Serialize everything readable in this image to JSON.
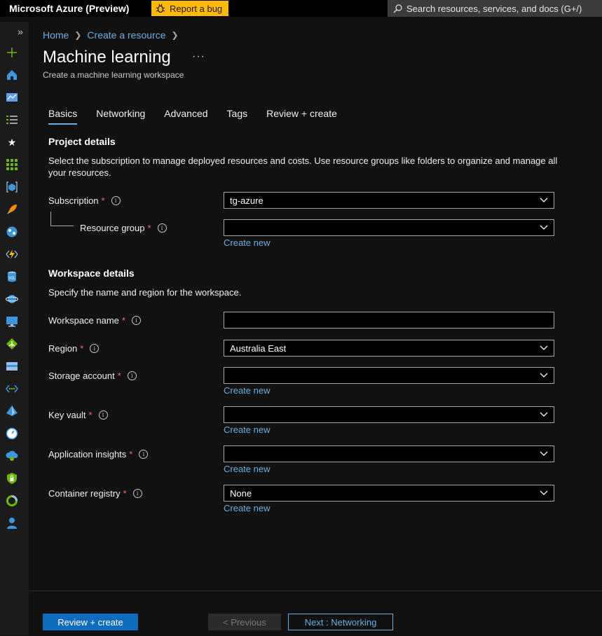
{
  "topbar": {
    "brand": "Microsoft Azure (Preview)",
    "report_bug": "Report a bug",
    "search_placeholder": "Search resources, services, and docs (G+/)"
  },
  "sidebar": {
    "expand_icon": "chevron-double-right-icon",
    "icons": [
      "create-resource-icon",
      "home-icon",
      "dashboard-icon",
      "all-services-icon",
      "favorites-icon",
      "all-resources-icon",
      "resource-groups-icon",
      "app-services-icon",
      "cosmos-db-icon",
      "function-app-icon",
      "sql-database-icon",
      "cosmos-icon",
      "virtual-machine-icon",
      "load-balancer-icon",
      "storage-account-icon",
      "virtual-network-icon",
      "azure-ad-icon",
      "monitor-icon",
      "advisor-icon",
      "security-center-icon",
      "cost-management-icon",
      "help-support-icon"
    ]
  },
  "breadcrumb": {
    "home": "Home",
    "create": "Create a resource"
  },
  "page": {
    "title": "Machine learning",
    "more": "···",
    "subtitle": "Create a machine learning workspace"
  },
  "tabs": [
    "Basics",
    "Networking",
    "Advanced",
    "Tags",
    "Review + create"
  ],
  "project": {
    "heading": "Project details",
    "description": "Select the subscription to manage deployed resources and costs. Use resource groups like folders to organize and manage all your resources.",
    "subscription_label": "Subscription",
    "subscription_value": "tg-azure",
    "resource_group_label": "Resource group",
    "resource_group_value": "",
    "create_new": "Create new"
  },
  "workspace": {
    "heading": "Workspace details",
    "description": "Specify the name and region for the workspace.",
    "name_label": "Workspace name",
    "name_value": "",
    "region_label": "Region",
    "region_value": "Australia East",
    "storage_label": "Storage account",
    "storage_value": "",
    "keyvault_label": "Key vault",
    "keyvault_value": "",
    "appinsights_label": "Application insights",
    "appinsights_value": "",
    "registry_label": "Container registry",
    "registry_value": "None",
    "create_new": "Create new"
  },
  "required_marker": "*",
  "info_marker": "i",
  "footer": {
    "review_create": "Review + create",
    "previous": "< Previous",
    "next": "Next : Networking"
  },
  "colors": {
    "accent": "#69afe5",
    "required": "#ff6565",
    "primary_button": "#0f6cbd",
    "bug_button": "#ffb900"
  }
}
